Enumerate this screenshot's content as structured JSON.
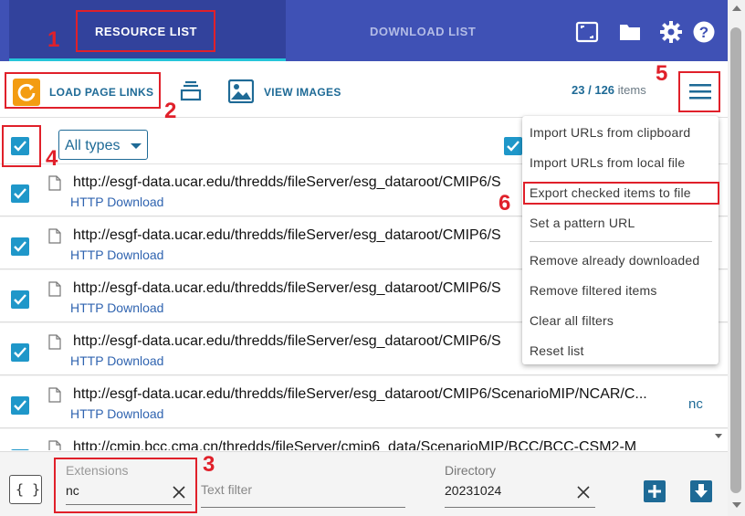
{
  "header": {
    "tabs": [
      {
        "label": "RESOURCE LIST",
        "active": true
      },
      {
        "label": "DOWNLOAD LIST",
        "active": false
      }
    ],
    "icons": [
      "fullscreen-icon",
      "folder-icon",
      "gear-icon",
      "help-icon"
    ]
  },
  "toolbar": {
    "load_label": "LOAD PAGE LINKS",
    "view_images_label": "VIEW IMAGES",
    "count_current": "23",
    "count_sep": "/",
    "count_total": "126",
    "count_unit": "items"
  },
  "filters": {
    "type_filter": "All types"
  },
  "rows": [
    {
      "url": "http://esgf-data.ucar.edu/thredds/fileServer/esg_dataroot/CMIP6/S",
      "type": "HTTP Download",
      "ext": ""
    },
    {
      "url": "http://esgf-data.ucar.edu/thredds/fileServer/esg_dataroot/CMIP6/S",
      "type": "HTTP Download",
      "ext": ""
    },
    {
      "url": "http://esgf-data.ucar.edu/thredds/fileServer/esg_dataroot/CMIP6/S",
      "type": "HTTP Download",
      "ext": ""
    },
    {
      "url": "http://esgf-data.ucar.edu/thredds/fileServer/esg_dataroot/CMIP6/S",
      "type": "HTTP Download",
      "ext": ""
    },
    {
      "url": "http://esgf-data.ucar.edu/thredds/fileServer/esg_dataroot/CMIP6/ScenarioMIP/NCAR/C...",
      "type": "HTTP Download",
      "ext": "nc"
    },
    {
      "url": "http://cmip.bcc.cma.cn/thredds/fileServer/cmip6_data/ScenarioMIP/BCC/BCC-CSM2-M",
      "type": "",
      "ext": ""
    }
  ],
  "menu": {
    "items": [
      "Import URLs from clipboard",
      "Import URLs from local file",
      "Export checked items to file",
      "Set a pattern URL",
      "Remove already downloaded",
      "Remove filtered items",
      "Clear all filters",
      "Reset list"
    ]
  },
  "footer": {
    "braces_label": "{ }",
    "extensions_label": "Extensions",
    "extensions_value": "nc",
    "text_filter_placeholder": "Text filter",
    "directory_label": "Directory",
    "directory_value": "20231024"
  },
  "annotations": [
    "1",
    "2",
    "3",
    "4",
    "5",
    "6"
  ],
  "colors": {
    "header_bg": "#3f51b5",
    "active_tab_bg": "#32429c",
    "active_tab_underline": "#26c6da",
    "accent": "#1e6a96",
    "checkbox": "#1f97c9",
    "load_icon": "#f39c12",
    "annotation": "#e0202a"
  }
}
